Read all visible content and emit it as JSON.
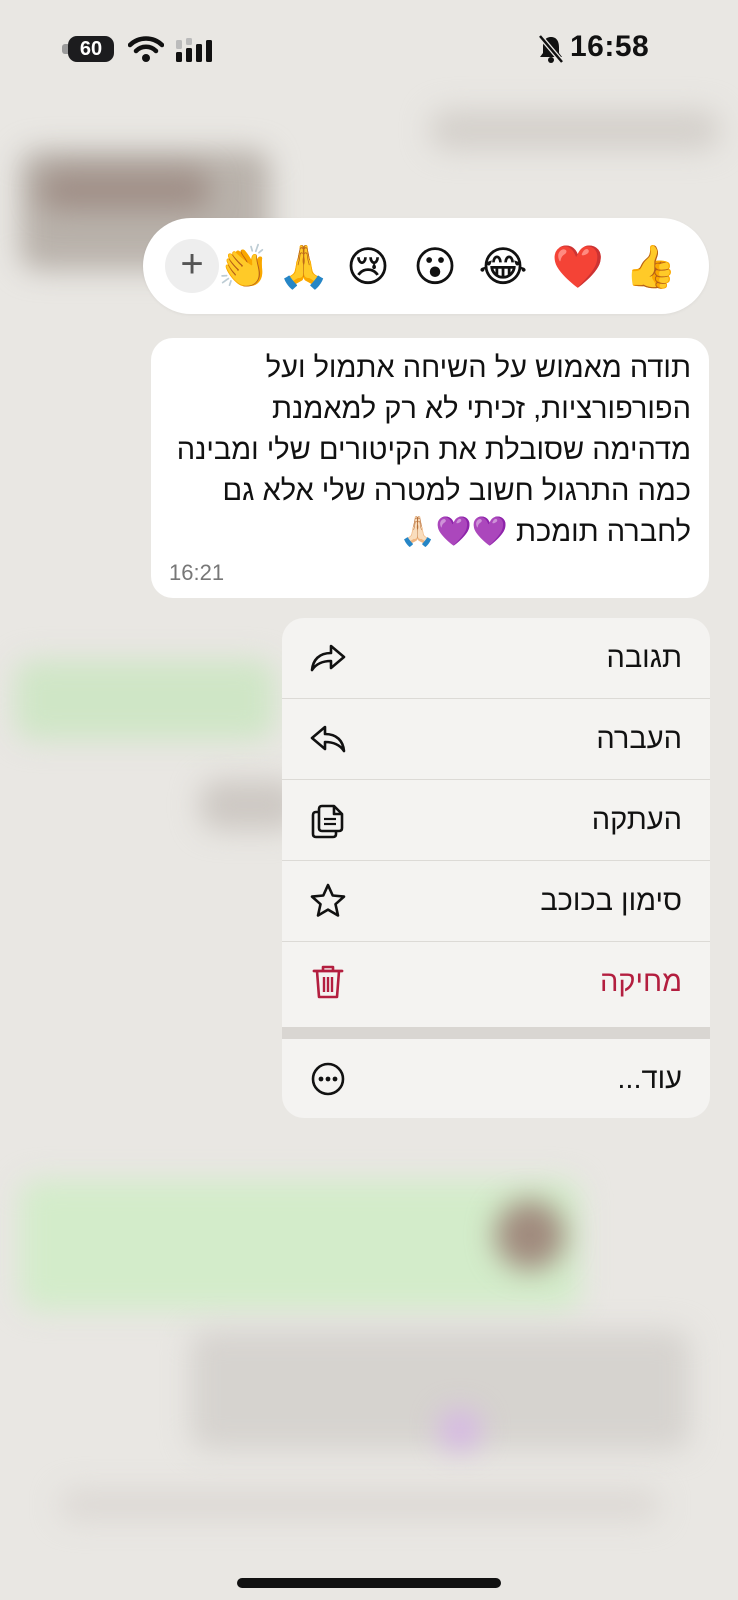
{
  "status_bar": {
    "battery_level": "60",
    "time": "16:58",
    "icons": [
      "battery-icon",
      "wifi-icon",
      "cellular-signal-icon",
      "silent-bell-icon"
    ]
  },
  "reactions": {
    "add_label": "+",
    "items": [
      {
        "name": "clapping-hands",
        "glyph": "👏"
      },
      {
        "name": "folded-hands",
        "glyph": "🙏"
      },
      {
        "name": "crying-face",
        "glyph": "😢"
      },
      {
        "name": "surprised-face",
        "glyph": "😮"
      },
      {
        "name": "tears-of-joy-face",
        "glyph": "😂"
      },
      {
        "name": "red-heart",
        "glyph": "❤️"
      },
      {
        "name": "thumbs-up",
        "glyph": "👍"
      }
    ]
  },
  "message": {
    "text": "תודה מאמוש על השיחה אתמול ועל הפורפורציות, זכיתי לא רק למאמנת מדהימה שסובלת את הקיטורים שלי ומבינה כמה התרגול חשוב למטרה שלי אלא גם לחברה תומכת 💜💜🙏🏻",
    "time": "16:21"
  },
  "menu": {
    "reply": {
      "label": "תגובה",
      "icon": "reply-arrow-icon"
    },
    "forward": {
      "label": "העברה",
      "icon": "forward-arrow-icon"
    },
    "copy": {
      "label": "העתקה",
      "icon": "copy-icon"
    },
    "star": {
      "label": "סימון בכוכב",
      "icon": "star-icon"
    },
    "delete": {
      "label": "מחיקה",
      "icon": "trash-icon",
      "color": "#b31e3f"
    },
    "more": {
      "label": "עוד...",
      "icon": "more-ellipsis-icon"
    }
  }
}
